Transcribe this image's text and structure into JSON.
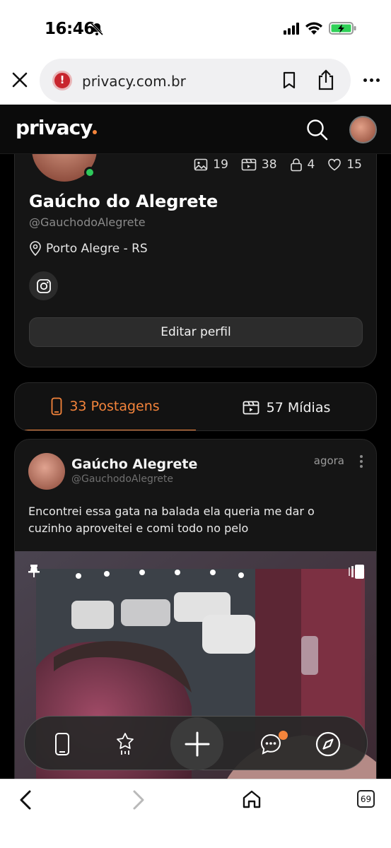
{
  "status_bar": {
    "time": "16:46"
  },
  "browser": {
    "url": "privacy.com.br"
  },
  "app": {
    "brand": "privacy",
    "brand_accent": "#f4843b"
  },
  "profile": {
    "name": "Gaúcho do Alegrete",
    "handle": "@GauchodoAlegrete",
    "location": "Porto Alegre - RS",
    "stats": {
      "photos": "19",
      "videos": "38",
      "locked": "4",
      "likes": "15"
    },
    "edit_label": "Editar perfil"
  },
  "tabs": {
    "posts_label": "33 Postagens",
    "media_label": "57 Mídias"
  },
  "post": {
    "author": "Gaúcho Alegrete",
    "handle": "@GauchodoAlegrete",
    "time": "agora",
    "text": "Encontrei essa gata na balada ela queria me dar o cuzinho aproveitei e comi todo no pelo"
  },
  "browser_tabs_count": "69"
}
